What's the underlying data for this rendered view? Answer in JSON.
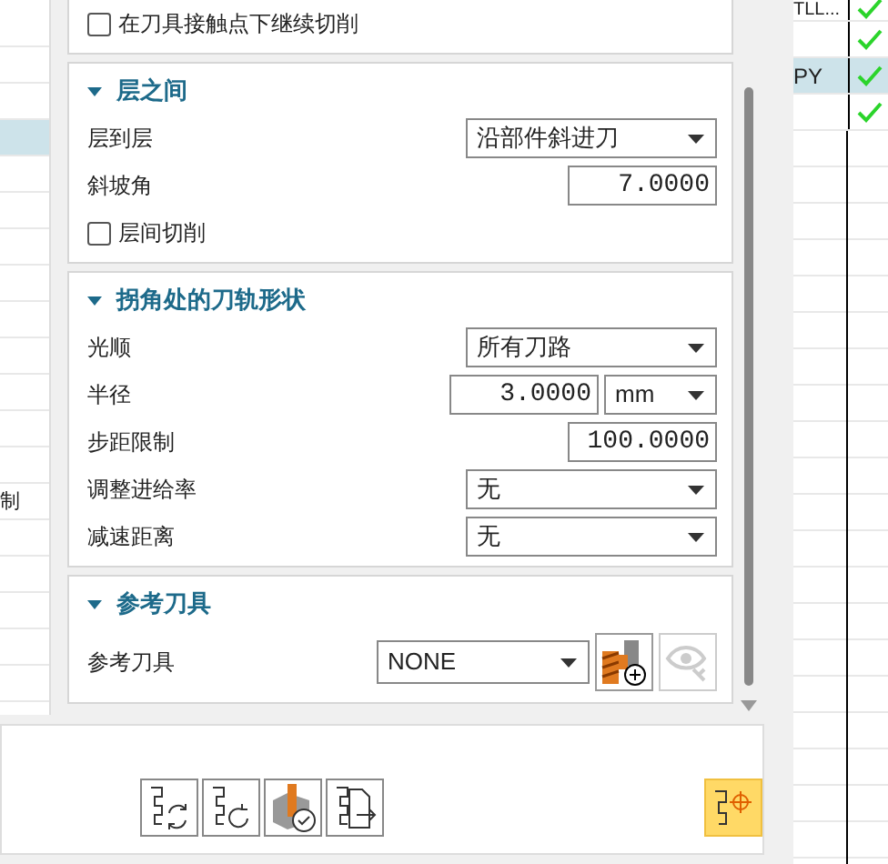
{
  "left_list": {
    "rows": [
      {
        "selected": false
      },
      {
        "selected": false
      },
      {
        "selected": false
      },
      {
        "selected": true
      },
      {
        "selected": false
      },
      {
        "selected": false
      },
      {
        "selected": false
      },
      {
        "selected": false
      },
      {
        "selected": false
      },
      {
        "selected": false
      },
      {
        "selected": false
      },
      {
        "selected": false
      },
      {
        "selected": false
      },
      {
        "selected": false,
        "text": "制"
      },
      {
        "selected": false
      },
      {
        "selected": false
      },
      {
        "selected": false
      },
      {
        "selected": false
      },
      {
        "selected": false
      }
    ]
  },
  "sections": [
    {
      "rows": [
        {
          "kind": "checkbox",
          "label": "在刀具接触点下继续切削",
          "checked": false
        }
      ]
    },
    {
      "title": "层之间",
      "expanded": true,
      "rows": [
        {
          "kind": "dropdown",
          "label": "层到层",
          "value": "沿部件斜进刀"
        },
        {
          "kind": "number",
          "label": "斜坡角",
          "value": "7.0000"
        },
        {
          "kind": "checkbox",
          "label": "层间切削",
          "checked": false
        }
      ]
    },
    {
      "title": "拐角处的刀轨形状",
      "expanded": true,
      "rows": [
        {
          "kind": "dropdown",
          "label": "光顺",
          "value": "所有刀路"
        },
        {
          "kind": "number_unit",
          "label": "半径",
          "value": "3.0000",
          "unit": "mm"
        },
        {
          "kind": "number",
          "label": "步距限制",
          "value": "100.0000"
        },
        {
          "kind": "dropdown",
          "label": "调整进给率",
          "value": "无"
        },
        {
          "kind": "dropdown",
          "label": "减速距离",
          "value": "无"
        }
      ]
    },
    {
      "title": "参考刀具",
      "expanded": true,
      "rows": [
        {
          "kind": "tool",
          "label": "参考刀具",
          "value": "NONE"
        }
      ]
    }
  ],
  "operations": [
    {
      "name": "TLL...",
      "checked": true,
      "selected": false
    },
    {
      "checked": true,
      "selected": false
    },
    {
      "name": "PY",
      "checked": true,
      "selected": true
    },
    {
      "checked": true,
      "selected": false
    }
  ]
}
